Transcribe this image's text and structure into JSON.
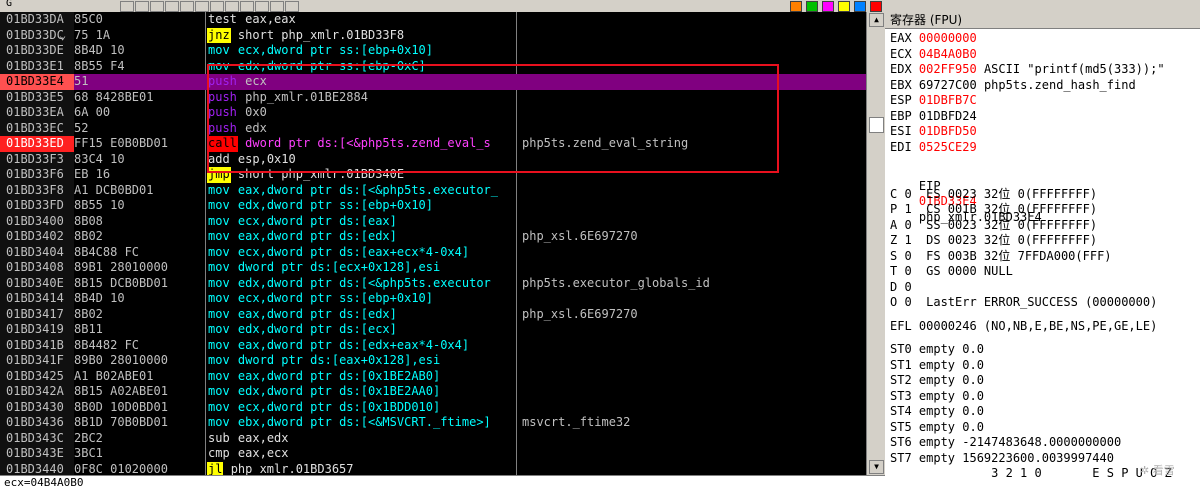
{
  "toolbar": {
    "label": "G"
  },
  "disasm": {
    "rows": [
      {
        "addr": "01BD33DA",
        "hex": "85C0",
        "mn": "test",
        "mcls": "def",
        "ops": "eax,eax",
        "cmt": ""
      },
      {
        "addr": "01BD33DC",
        "hex": "75 1A",
        "mn": "jnz",
        "mcls": "jmp",
        "ops": "short php_xmlr.01BD33F8",
        "cmt": "",
        "jmark": "⌄"
      },
      {
        "addr": "01BD33DE",
        "hex": "8B4D 10",
        "mn": "mov",
        "mcls": "mov",
        "ops": "ecx,dword ptr ss:[ebp+0x10]",
        "cmt": ""
      },
      {
        "addr": "01BD33E1",
        "hex": "8B55 F4",
        "mn": "mov",
        "mcls": "mov",
        "ops": "edx,dword ptr ss:[ebp-0xC]",
        "cmt": ""
      },
      {
        "addr": "01BD33E4",
        "hex": "51",
        "mn": "push",
        "mcls": "push",
        "ops": "ecx",
        "cmt": "",
        "sel": true
      },
      {
        "addr": "01BD33E5",
        "hex": "68 8428BE01",
        "mn": "push",
        "mcls": "push",
        "ops": "php_xmlr.01BE2884",
        "cmt": ""
      },
      {
        "addr": "01BD33EA",
        "hex": "6A 00",
        "mn": "push",
        "mcls": "push",
        "ops": "0x0",
        "cmt": ""
      },
      {
        "addr": "01BD33EC",
        "hex": "52",
        "mn": "push",
        "mcls": "push",
        "ops": "edx",
        "cmt": ""
      },
      {
        "addr": "01BD33ED",
        "hex": "FF15 E0B0BD01",
        "mn": "call",
        "mcls": "call",
        "ops": "dword ptr ds:[<&php5ts.zend_eval_s",
        "cmt": "php5ts.zend_eval_string",
        "bp": true
      },
      {
        "addr": "01BD33F3",
        "hex": "83C4 10",
        "mn": "add",
        "mcls": "def",
        "ops": "esp,0x10",
        "cmt": ""
      },
      {
        "addr": "01BD33F6",
        "hex": "EB 16",
        "mn": "jmp",
        "mcls": "jmp",
        "ops": "short php_xmlr.01BD340E",
        "cmt": ""
      },
      {
        "addr": "01BD33F8",
        "hex": "A1 DCB0BD01",
        "mn": "mov",
        "mcls": "mov",
        "ops": "eax,dword ptr ds:[<&php5ts.executor_",
        "cmt": ""
      },
      {
        "addr": "01BD33FD",
        "hex": "8B55 10",
        "mn": "mov",
        "mcls": "mov",
        "ops": "edx,dword ptr ss:[ebp+0x10]",
        "cmt": ""
      },
      {
        "addr": "01BD3400",
        "hex": "8B08",
        "mn": "mov",
        "mcls": "mov",
        "ops": "ecx,dword ptr ds:[eax]",
        "cmt": ""
      },
      {
        "addr": "01BD3402",
        "hex": "8B02",
        "mn": "mov",
        "mcls": "mov",
        "ops": "eax,dword ptr ds:[edx]",
        "cmt": "php_xsl.6E697270"
      },
      {
        "addr": "01BD3404",
        "hex": "8B4C88 FC",
        "mn": "mov",
        "mcls": "mov",
        "ops": "ecx,dword ptr ds:[eax+ecx*4-0x4]",
        "cmt": ""
      },
      {
        "addr": "01BD3408",
        "hex": "89B1 28010000",
        "mn": "mov",
        "mcls": "mov",
        "ops": "dword ptr ds:[ecx+0x128],esi",
        "cmt": ""
      },
      {
        "addr": "01BD340E",
        "hex": "8B15 DCB0BD01",
        "mn": "mov",
        "mcls": "mov",
        "ops": "edx,dword ptr ds:[<&php5ts.executor",
        "cmt": "php5ts.executor_globals_id"
      },
      {
        "addr": "01BD3414",
        "hex": "8B4D 10",
        "mn": "mov",
        "mcls": "mov",
        "ops": "ecx,dword ptr ss:[ebp+0x10]",
        "cmt": ""
      },
      {
        "addr": "01BD3417",
        "hex": "8B02",
        "mn": "mov",
        "mcls": "mov",
        "ops": "eax,dword ptr ds:[edx]",
        "cmt": "php_xsl.6E697270"
      },
      {
        "addr": "01BD3419",
        "hex": "8B11",
        "mn": "mov",
        "mcls": "mov",
        "ops": "edx,dword ptr ds:[ecx]",
        "cmt": ""
      },
      {
        "addr": "01BD341B",
        "hex": "8B4482 FC",
        "mn": "mov",
        "mcls": "mov",
        "ops": "eax,dword ptr ds:[edx+eax*4-0x4]",
        "cmt": ""
      },
      {
        "addr": "01BD341F",
        "hex": "89B0 28010000",
        "mn": "mov",
        "mcls": "mov",
        "ops": "dword ptr ds:[eax+0x128],esi",
        "cmt": ""
      },
      {
        "addr": "01BD3425",
        "hex": "A1 B02ABE01",
        "mn": "mov",
        "mcls": "mov",
        "ops": "eax,dword ptr ds:[0x1BE2AB0]",
        "cmt": ""
      },
      {
        "addr": "01BD342A",
        "hex": "8B15 A02ABE01",
        "mn": "mov",
        "mcls": "mov",
        "ops": "edx,dword ptr ds:[0x1BE2AA0]",
        "cmt": ""
      },
      {
        "addr": "01BD3430",
        "hex": "8B0D 10D0BD01",
        "mn": "mov",
        "mcls": "mov",
        "ops": "ecx,dword ptr ds:[0x1BDD010]",
        "cmt": ""
      },
      {
        "addr": "01BD3436",
        "hex": "8B1D 70B0BD01",
        "mn": "mov",
        "mcls": "mov",
        "ops": "ebx,dword ptr ds:[<&MSVCRT._ftime>]",
        "cmt": "msvcrt._ftime32"
      },
      {
        "addr": "01BD343C",
        "hex": "2BC2",
        "mn": "sub",
        "mcls": "def",
        "ops": "eax,edx",
        "cmt": ""
      },
      {
        "addr": "01BD343E",
        "hex": "3BC1",
        "mn": "cmp",
        "mcls": "cmp",
        "ops": "eax,ecx",
        "cmt": ""
      },
      {
        "addr": "01BD3440",
        "hex": "0F8C 01020000",
        "mn": "jl",
        "mcls": "jmp",
        "ops": "php_xmlr.01BD3657",
        "cmt": ""
      }
    ]
  },
  "registers": {
    "title": "寄存器 (FPU)",
    "gp": [
      {
        "name": "EAX",
        "value": "00000000",
        "changed": true,
        "note": ""
      },
      {
        "name": "ECX",
        "value": "04B4A0B0",
        "changed": true,
        "note": ""
      },
      {
        "name": "EDX",
        "value": "002FF950",
        "changed": true,
        "note": "ASCII \"printf(md5(333));\""
      },
      {
        "name": "EBX",
        "value": "69727C00",
        "changed": false,
        "note": "php5ts.zend_hash_find"
      },
      {
        "name": "ESP",
        "value": "01DBFB7C",
        "changed": true,
        "note": ""
      },
      {
        "name": "EBP",
        "value": "01DBFD24",
        "changed": false,
        "note": ""
      },
      {
        "name": "ESI",
        "value": "01DBFD50",
        "changed": true,
        "note": ""
      },
      {
        "name": "EDI",
        "value": "0525CE29",
        "changed": true,
        "note": ""
      }
    ],
    "eip": {
      "name": "EIP",
      "value": "01BD33E4",
      "note": "php_xmlr.01BD33E4"
    },
    "flags": [
      "C 0  ES 0023 32位 0(FFFFFFFF)",
      "P 1  CS 001B 32位 0(FFFFFFFF)",
      "A 0  SS 0023 32位 0(FFFFFFFF)",
      "Z 1  DS 0023 32位 0(FFFFFFFF)",
      "S 0  FS 003B 32位 7FFDA000(FFF)",
      "T 0  GS 0000 NULL",
      "D 0",
      "O 0  LastErr ERROR_SUCCESS (00000000)"
    ],
    "efl": "EFL 00000246 (NO,NB,E,BE,NS,PE,GE,LE)",
    "fpu": [
      "ST0 empty 0.0",
      "ST1 empty 0.0",
      "ST2 empty 0.0",
      "ST3 empty 0.0",
      "ST4 empty 0.0",
      "ST5 empty 0.0",
      "ST6 empty -2147483648.0000000000",
      "ST7 empty 1569223600.0039997440"
    ],
    "fpu_footer": "              3 2 1 0       E S P U O Z"
  },
  "status": {
    "text": "ecx=04B4A0B0"
  },
  "colors": {
    "selected_row": "#800080",
    "breakpoint": "#ff2020",
    "highlight_box": "#e8101e"
  }
}
